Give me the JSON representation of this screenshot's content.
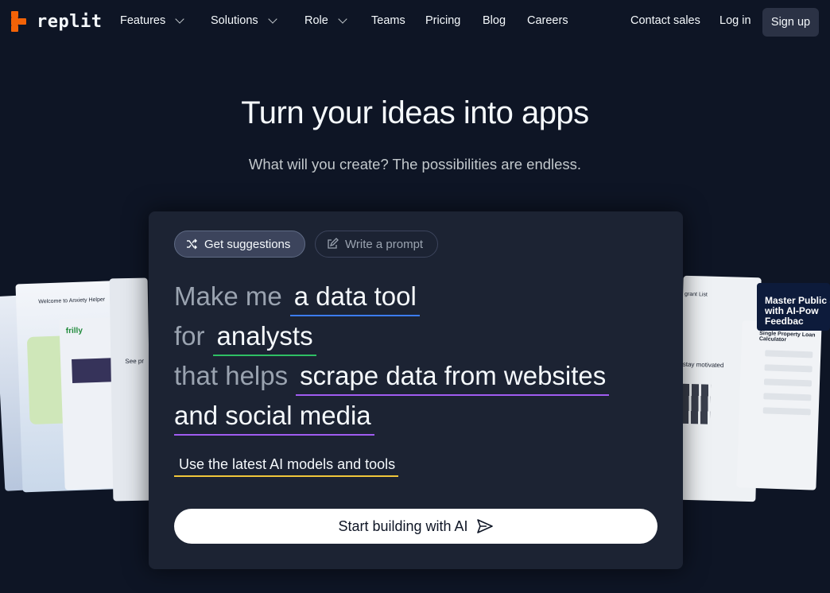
{
  "nav": {
    "logo_text": "replit",
    "items": [
      "Features",
      "Solutions",
      "Role",
      "Teams",
      "Pricing",
      "Blog",
      "Careers"
    ],
    "contact_sales": "Contact sales",
    "log_in": "Log in",
    "sign_up": "Sign up"
  },
  "hero": {
    "title": "Turn your ideas into apps",
    "subtitle": "What will you create? The possibilities are endless."
  },
  "panel": {
    "tabs": [
      "Get suggestions",
      "Write a prompt"
    ],
    "prompt": {
      "prefix1": "Make me",
      "value1": "a data tool",
      "prefix2": "for",
      "value2": "analysts",
      "prefix3": "that helps",
      "value3": "scrape data from websites",
      "value4": "and social media"
    },
    "underline_colors": [
      "#3c7cf0",
      "#2fbf64",
      "#a05cf0",
      "#a05cf0"
    ],
    "models_label": "Use the latest AI models and tools",
    "start_button": "Start building with AI"
  },
  "background_cards": {
    "left_card_title": "Welcome to Anxiety Helper",
    "left_brand": "frilly",
    "left_text": "See pr",
    "right_card_title": "grant List",
    "right_card_text": "stay motivated",
    "right_card2_title": "Single Property Loan Calculator",
    "right_promo": "Master Public S with AI-Pow Feedbac"
  }
}
